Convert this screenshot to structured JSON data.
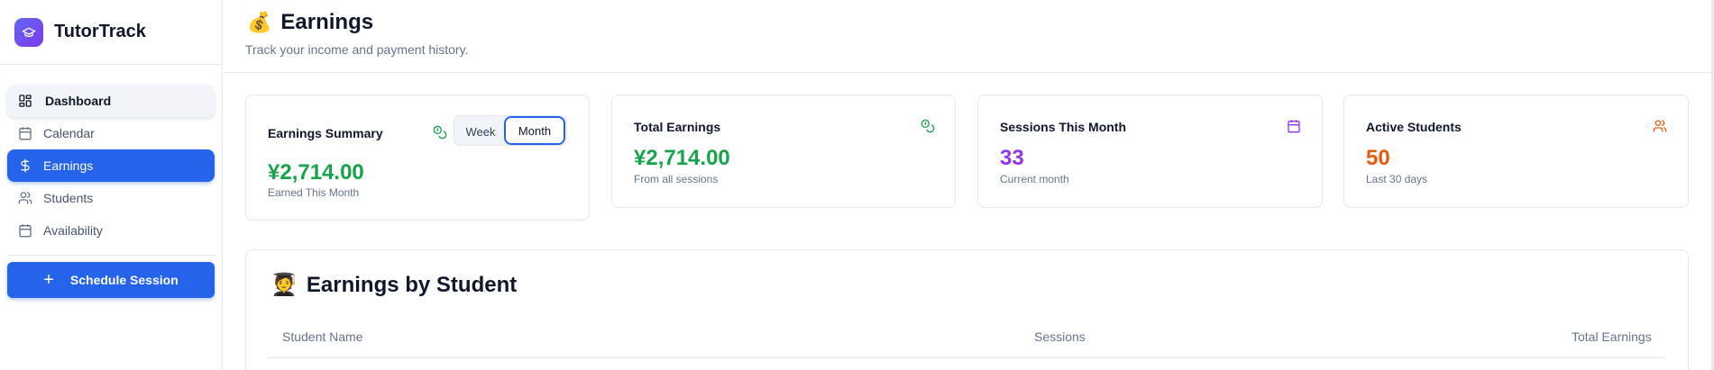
{
  "brand": {
    "name": "TutorTrack",
    "logo_icon": "graduation-cap-icon"
  },
  "sidebar": {
    "items": [
      {
        "label": "Dashboard",
        "icon": "dashboard-grid-icon"
      },
      {
        "label": "Calendar",
        "icon": "calendar-icon"
      },
      {
        "label": "Earnings",
        "icon": "dollar-icon",
        "active": true
      },
      {
        "label": "Students",
        "icon": "users-icon"
      },
      {
        "label": "Availability",
        "icon": "calendar-icon"
      }
    ],
    "schedule_button": "Schedule Session"
  },
  "header": {
    "emoji": "💰",
    "title": "Earnings",
    "subtitle": "Track your income and payment history."
  },
  "cards": {
    "summary": {
      "title": "Earnings Summary",
      "value": "¥2,714.00",
      "sub": "Earned This Month",
      "toggle": {
        "week": "Week",
        "month": "Month",
        "selected": "Month"
      }
    },
    "total": {
      "title": "Total Earnings",
      "value": "¥2,714.00",
      "sub": "From all sessions"
    },
    "sessions": {
      "title": "Sessions This Month",
      "value": "33",
      "sub": "Current month"
    },
    "students": {
      "title": "Active Students",
      "value": "50",
      "sub": "Last 30 days"
    }
  },
  "by_student": {
    "emoji": "🧑‍🎓",
    "title": "Earnings by Student",
    "columns": [
      "Student Name",
      "Sessions",
      "Total Earnings"
    ]
  },
  "colors": {
    "primary": "#2563eb",
    "green": "#16a34a",
    "purple": "#9333ea",
    "orange": "#ea580c"
  }
}
